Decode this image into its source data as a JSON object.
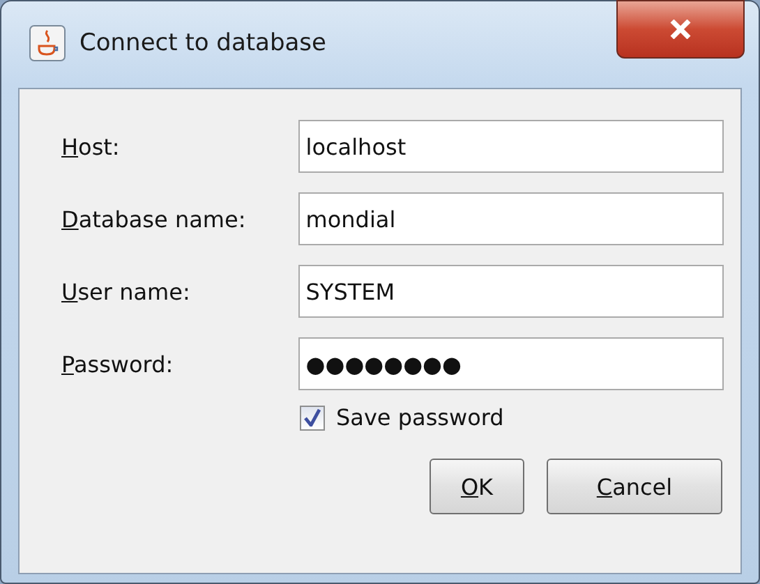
{
  "window": {
    "title": "Connect to database"
  },
  "fields": [
    {
      "label": "Host:",
      "value": "localhost",
      "mnemonic": true
    },
    {
      "label": "Database name:",
      "value": "mondial",
      "mnemonic": true
    },
    {
      "label": "User name:",
      "value": "SYSTEM",
      "mnemonic": true
    },
    {
      "label": "Password:",
      "value": "●●●●●●●●",
      "mnemonic": true
    }
  ],
  "save_password": {
    "label": "Save password",
    "checked": true
  },
  "buttons": [
    {
      "label": "OK",
      "mnemonic": true
    },
    {
      "label": "Cancel",
      "mnemonic": true
    }
  ]
}
